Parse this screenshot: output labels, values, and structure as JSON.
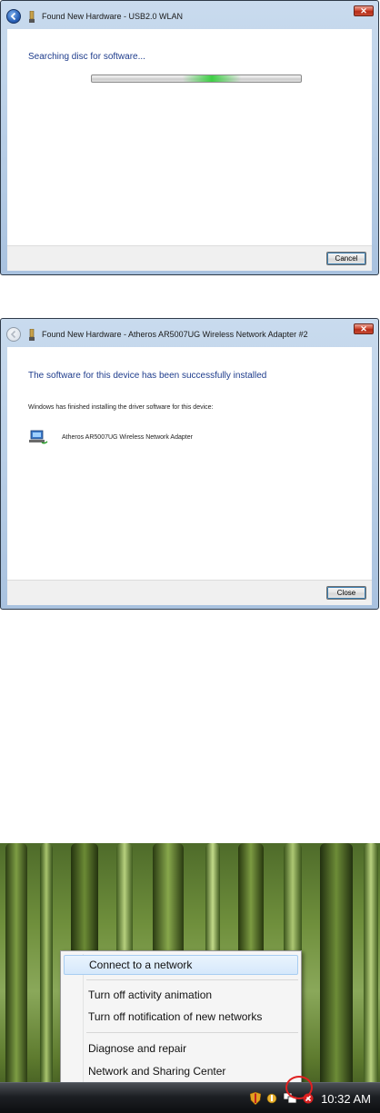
{
  "window1": {
    "title": "Found New Hardware - USB2.0 WLAN",
    "heading": "Searching disc for software...",
    "progress_state": "indeterminate",
    "button_label": "Cancel"
  },
  "window2": {
    "title": "Found New Hardware - Atheros AR5007UG Wireless Network Adapter #2",
    "heading": "The software for this device has been successfully installed",
    "subtext": "Windows has finished installing the driver software for this device:",
    "device_label": "Atheros AR5007UG Wireless Network Adapter",
    "button_label": "Close"
  },
  "context_menu": {
    "items": [
      {
        "label": "Connect to a network",
        "highlighted": true
      },
      {
        "label": "Turn off activity animation",
        "highlighted": false
      },
      {
        "label": "Turn off notification of new networks",
        "highlighted": false
      },
      {
        "label": "Diagnose and repair",
        "highlighted": false
      },
      {
        "label": "Network and Sharing Center",
        "highlighted": false
      }
    ]
  },
  "taskbar": {
    "clock": "10:32 AM",
    "tray_icons": [
      "security-shield-icon",
      "volume-icon",
      "network-icon",
      "network-error-icon"
    ]
  },
  "colors": {
    "heading_blue": "#1e3c8c",
    "progress_green": "#3ecf45",
    "close_button_red": "#c74a33"
  }
}
